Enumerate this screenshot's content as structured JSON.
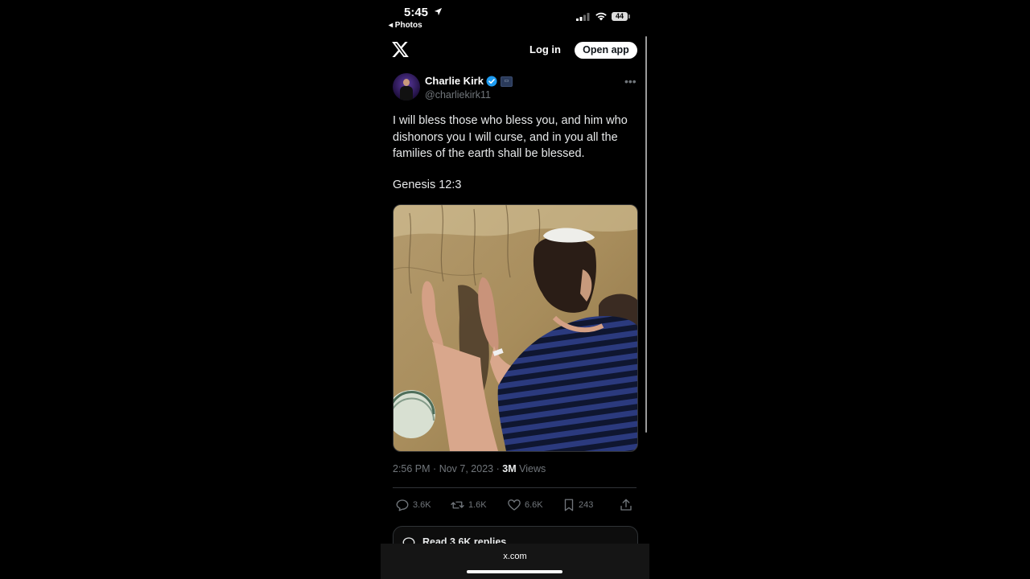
{
  "status_bar": {
    "time": "5:45",
    "back_app": "◂ Photos",
    "battery": "44"
  },
  "header": {
    "login_label": "Log in",
    "open_app_label": "Open app"
  },
  "tweet": {
    "author_name": "Charlie Kirk",
    "handle": "@charliekirk11",
    "text": "I will bless those who bless you, and him who dishonors you I will curse, and in you all the families of the earth shall be blessed.",
    "reference": "Genesis 12:3",
    "time": "2:56 PM",
    "date": "Nov 7, 2023",
    "views_count": "3M",
    "views_label": "Views",
    "separator": "·"
  },
  "actions": {
    "replies": "3.6K",
    "reposts": "1.6K",
    "likes": "6.6K",
    "bookmarks": "243"
  },
  "read_replies_label": "Read 3.6K replies",
  "browser": {
    "domain": "x.com"
  },
  "colors": {
    "background": "#000000",
    "text_primary": "#e7e9ea",
    "text_secondary": "#71767b",
    "verified_blue": "#1d9bf0"
  }
}
